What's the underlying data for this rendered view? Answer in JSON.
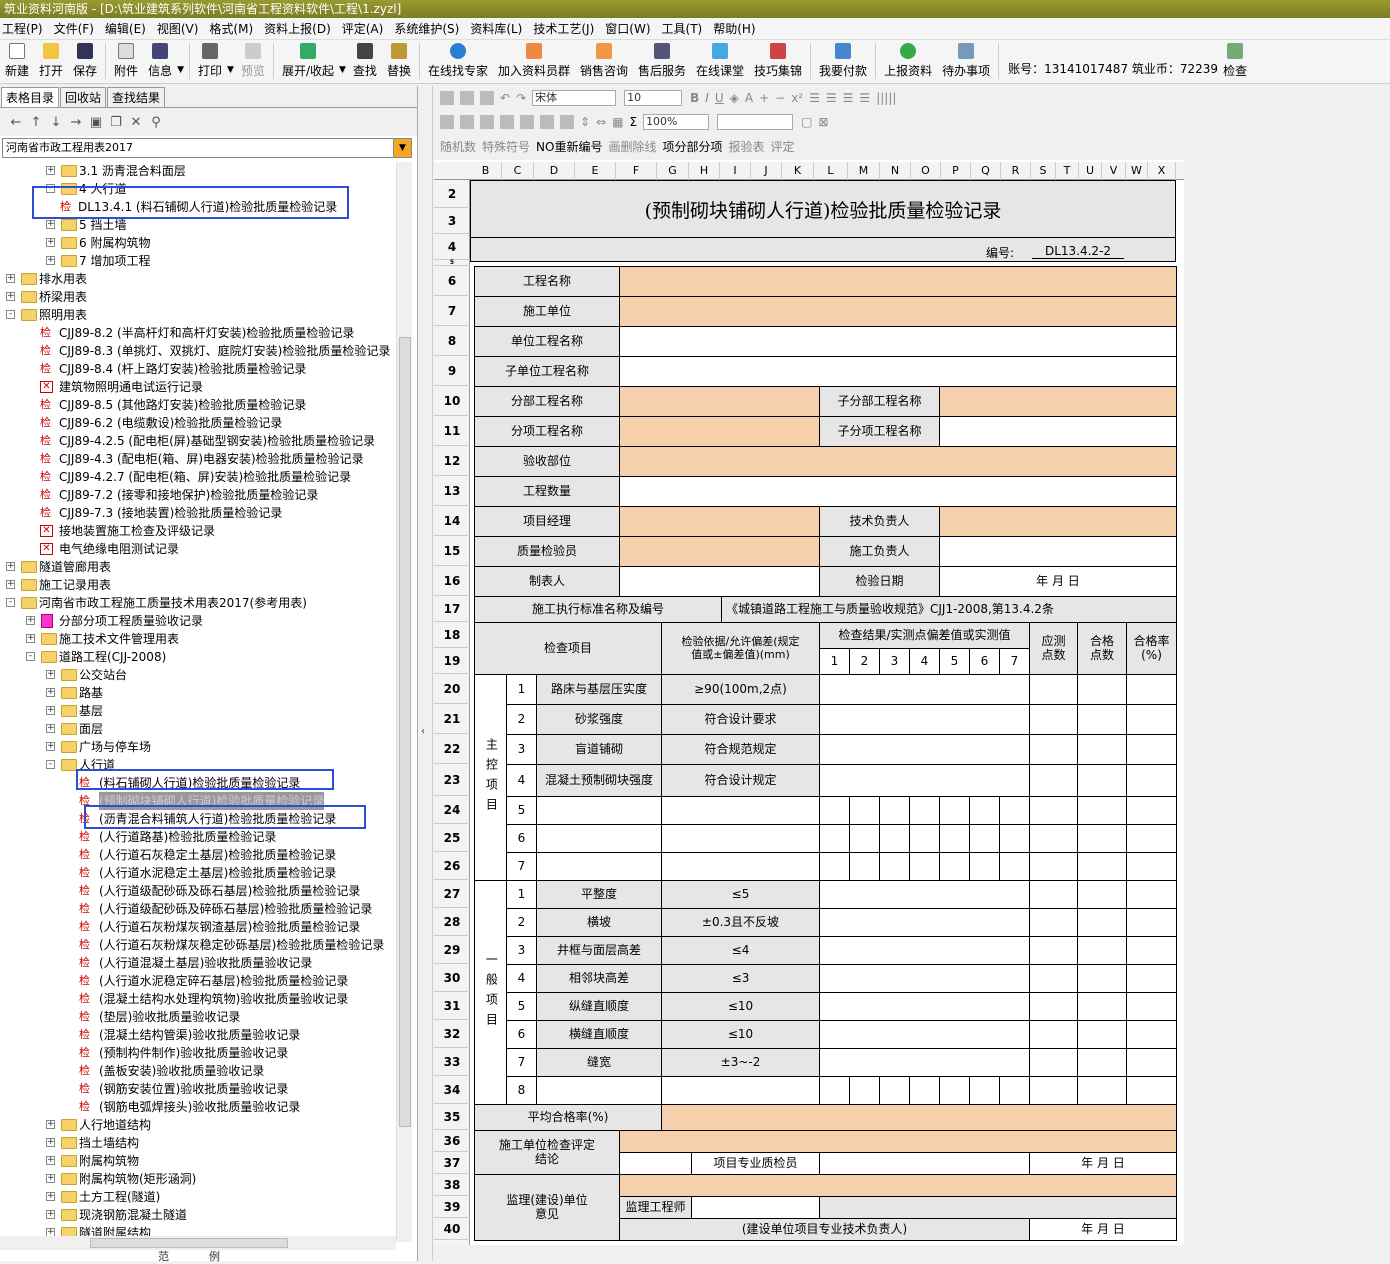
{
  "window": {
    "title": "筑业资料河南版 - [D:\\筑业建筑系列软件\\河南省工程资料软件\\工程\\1.zyzl]"
  },
  "menu": [
    "工程(P)",
    "文件(F)",
    "编辑(E)",
    "视图(V)",
    "格式(M)",
    "资料上报(D)",
    "评定(A)",
    "系统维护(S)",
    "资料库(L)",
    "技术工艺(J)",
    "窗口(W)",
    "工具(T)",
    "帮助(H)"
  ],
  "toolbar": {
    "new": "新建",
    "open": "打开",
    "save": "保存",
    "attach": "附件",
    "info": "信息",
    "print": "打印",
    "preview": "预览",
    "expand": "展开/收起",
    "find": "查找",
    "replace": "替换",
    "online_expert": "在线找专家",
    "join_group": "加入资料员群",
    "sales": "销售咨询",
    "after_sales": "售后服务",
    "online_class": "在线课堂",
    "skills": "技巧集锦",
    "pay": "我要付款",
    "upload": "上报资料",
    "todo": "待办事项",
    "account": "账号：13141017487 筑业币：72239",
    "check": "检查"
  },
  "left": {
    "tabs": [
      "表格目录",
      "回收站",
      "查找结果"
    ],
    "combo": "河南省市政工程用表2017",
    "bottom": "范例",
    "tree": [
      {
        "l": "3.1 沥青混合料面层",
        "i": 2,
        "t": "fold",
        "e": "+"
      },
      {
        "l": "4 人行道",
        "i": 2,
        "t": "fold",
        "e": "-"
      },
      {
        "l": "DL13.4.1 (料石铺砌人行道)检验批质量检验记录",
        "i": 3,
        "t": "jian"
      },
      {
        "l": "5 挡土墙",
        "i": 2,
        "t": "fold",
        "e": "+"
      },
      {
        "l": "6 附属构筑物",
        "i": 2,
        "t": "fold",
        "e": "+"
      },
      {
        "l": "7 增加项工程",
        "i": 2,
        "t": "fold",
        "e": "+"
      },
      {
        "l": "排水用表",
        "i": 0,
        "t": "fold",
        "e": "+"
      },
      {
        "l": "桥梁用表",
        "i": 0,
        "t": "fold",
        "e": "+"
      },
      {
        "l": "照明用表",
        "i": 0,
        "t": "fold",
        "e": "-"
      },
      {
        "l": "CJJ89-8.2 (半高杆灯和高杆灯安装)检验批质量检验记录",
        "i": 1,
        "t": "jian"
      },
      {
        "l": "CJJ89-8.3 (单挑灯、双挑灯、庭院灯安装)检验批质量检验记录",
        "i": 1,
        "t": "jian"
      },
      {
        "l": "CJJ89-8.4 (杆上路灯安装)检验批质量检验记录",
        "i": 1,
        "t": "jian"
      },
      {
        "l": "建筑物照明通电试运行记录",
        "i": 1,
        "t": "x"
      },
      {
        "l": "CJJ89-8.5 (其他路灯安装)检验批质量检验记录",
        "i": 1,
        "t": "jian"
      },
      {
        "l": "CJJ89-6.2 (电缆敷设)检验批质量检验记录",
        "i": 1,
        "t": "jian"
      },
      {
        "l": "CJJ89-4.2.5 (配电柜(屏)基础型钢安装)检验批质量检验记录",
        "i": 1,
        "t": "jian"
      },
      {
        "l": "CJJ89-4.3 (配电柜(箱、屏)电器安装)检验批质量检验记录",
        "i": 1,
        "t": "jian"
      },
      {
        "l": "CJJ89-4.2.7 (配电柜(箱、屏)安装)检验批质量检验记录",
        "i": 1,
        "t": "jian"
      },
      {
        "l": "CJJ89-7.2 (接零和接地保护)检验批质量检验记录",
        "i": 1,
        "t": "jian"
      },
      {
        "l": "CJJ89-7.3 (接地装置)检验批质量检验记录",
        "i": 1,
        "t": "jian"
      },
      {
        "l": "接地装置施工检查及评级记录",
        "i": 1,
        "t": "x"
      },
      {
        "l": "电气绝缘电阻测试记录",
        "i": 1,
        "t": "x"
      },
      {
        "l": "隧道管廊用表",
        "i": 0,
        "t": "fold",
        "e": "+"
      },
      {
        "l": "施工记录用表",
        "i": 0,
        "t": "fold",
        "e": "+"
      },
      {
        "l": "河南省市政工程施工质量技术用表2017(参考用表)",
        "i": 0,
        "t": "fold",
        "e": "-"
      },
      {
        "l": "分部分项工程质量验收记录",
        "i": 1,
        "t": "p",
        "e": "+"
      },
      {
        "l": "施工技术文件管理用表",
        "i": 1,
        "t": "fold",
        "e": "+"
      },
      {
        "l": "道路工程(CJJ-2008)",
        "i": 1,
        "t": "fold",
        "e": "-"
      },
      {
        "l": "公交站台",
        "i": 2,
        "t": "fold",
        "e": "+"
      },
      {
        "l": "路基",
        "i": 2,
        "t": "fold",
        "e": "+"
      },
      {
        "l": "基层",
        "i": 2,
        "t": "fold",
        "e": "+"
      },
      {
        "l": "面层",
        "i": 2,
        "t": "fold",
        "e": "+"
      },
      {
        "l": "广场与停车场",
        "i": 2,
        "t": "fold",
        "e": "+"
      },
      {
        "l": "人行道",
        "i": 2,
        "t": "fold",
        "e": "-"
      },
      {
        "l": "(料石铺砌人行道)检验批质量检验记录",
        "i": 3,
        "t": "jian"
      },
      {
        "l": "(预制砌块铺砌人行道)检验批质量检验记录",
        "i": 3,
        "t": "jian",
        "sel": true
      },
      {
        "l": "(沥青混合料铺筑人行道)检验批质量检验记录",
        "i": 3,
        "t": "jian"
      },
      {
        "l": "(人行道路基)检验批质量检验记录",
        "i": 3,
        "t": "jian"
      },
      {
        "l": "(人行道石灰稳定土基层)检验批质量检验记录",
        "i": 3,
        "t": "jian"
      },
      {
        "l": "(人行道水泥稳定土基层)检验批质量检验记录",
        "i": 3,
        "t": "jian"
      },
      {
        "l": "(人行道级配砂砾及砾石基层)检验批质量检验记录",
        "i": 3,
        "t": "jian"
      },
      {
        "l": "(人行道级配砂砾及碎砾石基层)检验批质量检验记录",
        "i": 3,
        "t": "jian"
      },
      {
        "l": "(人行道石灰粉煤灰钢渣基层)检验批质量检验记录",
        "i": 3,
        "t": "jian"
      },
      {
        "l": "(人行道石灰粉煤灰稳定砂砾基层)检验批质量检验记录",
        "i": 3,
        "t": "jian"
      },
      {
        "l": "(人行道混凝土基层)验收批质量验收记录",
        "i": 3,
        "t": "jian"
      },
      {
        "l": "(人行道水泥稳定碎石基层)检验批质量检验记录",
        "i": 3,
        "t": "jian"
      },
      {
        "l": "(混凝土结构水处理构筑物)验收批质量验收记录",
        "i": 3,
        "t": "jian"
      },
      {
        "l": "(垫层)验收批质量验收记录",
        "i": 3,
        "t": "jian"
      },
      {
        "l": "(混凝土结构管渠)验收批质量验收记录",
        "i": 3,
        "t": "jian"
      },
      {
        "l": "(预制构件制作)验收批质量验收记录",
        "i": 3,
        "t": "jian"
      },
      {
        "l": "(盖板安装)验收批质量验收记录",
        "i": 3,
        "t": "jian"
      },
      {
        "l": "(钢筋安装位置)验收批质量验收记录",
        "i": 3,
        "t": "jian"
      },
      {
        "l": "(钢筋电弧焊接头)验收批质量验收记录",
        "i": 3,
        "t": "jian"
      },
      {
        "l": "人行地道结构",
        "i": 2,
        "t": "fold",
        "e": "+"
      },
      {
        "l": "挡土墙结构",
        "i": 2,
        "t": "fold",
        "e": "+"
      },
      {
        "l": "附属构筑物",
        "i": 2,
        "t": "fold",
        "e": "+"
      },
      {
        "l": "附属构筑物(矩形涵洞)",
        "i": 2,
        "t": "fold",
        "e": "+"
      },
      {
        "l": "土方工程(隧道)",
        "i": 2,
        "t": "fold",
        "e": "+"
      },
      {
        "l": "现浇钢筋混凝土隧道",
        "i": 2,
        "t": "fold",
        "e": "+"
      },
      {
        "l": "隧道附属结构",
        "i": 2,
        "t": "fold",
        "e": "+"
      }
    ]
  },
  "rtool": {
    "font": "宋体",
    "size": "10",
    "zoom": "100%",
    "sigma": "Σ",
    "row3": [
      "随机数",
      "特殊符号",
      "NO重新编号",
      "画删除线",
      "项分部分项",
      "报验表",
      "评定"
    ]
  },
  "cols": [
    "B",
    "C",
    "D",
    "E",
    "F",
    "G",
    "H",
    "I",
    "J",
    "K",
    "L",
    "M",
    "N",
    "O",
    "P",
    "Q",
    "R",
    "S",
    "T",
    "U",
    "V",
    "W",
    "X"
  ],
  "rows": [
    "2",
    "3",
    "4",
    "5",
    "6",
    "7",
    "8",
    "9",
    "10",
    "11",
    "12",
    "13",
    "14",
    "15",
    "16",
    "17",
    "18",
    "19",
    "20",
    "21",
    "22",
    "23",
    "24",
    "25",
    "26",
    "27",
    "28",
    "29",
    "30",
    "31",
    "32",
    "33",
    "34",
    "35",
    "36",
    "37",
    "38",
    "39",
    "40"
  ],
  "doc": {
    "title": "(预制砌块铺砌人行道)检验批质量检验记录",
    "num_label": "编号:",
    "num_value": "DL13.4.2-2",
    "project_name": "工程名称",
    "construction_unit": "施工单位",
    "unit_project": "单位工程名称",
    "sub_unit_project": "子单位工程名称",
    "division": "分部工程名称",
    "sub_division": "子分部工程名称",
    "item": "分项工程名称",
    "sub_item": "子分项工程名称",
    "accept_part": "验收部位",
    "quantity": "工程数量",
    "pm": "项目经理",
    "tech_lead": "技术负责人",
    "qc": "质量检验员",
    "const_lead": "施工负责人",
    "preparer": "制表人",
    "check_date": "检验日期",
    "ymd": "年  月  日",
    "std_label": "施工执行标准名称及编号",
    "std_value": "《城镇道路工程施工与质量验收规范》CJJ1-2008,第13.4.2条",
    "h_item": "检查项目",
    "h_basis": "检验依据/允许偏差(规定值或±偏差值)(mm)",
    "h_result": "检查结果/实测点偏差值或实测值",
    "h_should": "应测点数",
    "h_pass": "合格点数",
    "h_rate": "合格率(%)",
    "idx": [
      "1",
      "2",
      "3",
      "4",
      "5",
      "6",
      "7"
    ],
    "main_label": "主控项目",
    "general_label": "一般项目",
    "main": [
      {
        "n": "1",
        "name": "路床与基层压实度",
        "basis": "≥90(100m,2点)"
      },
      {
        "n": "2",
        "name": "砂浆强度",
        "basis": "符合设计要求"
      },
      {
        "n": "3",
        "name": "盲道铺砌",
        "basis": "符合规范规定"
      },
      {
        "n": "4",
        "name": "混凝土预制砌块强度",
        "basis": "符合设计规定"
      },
      {
        "n": "5",
        "name": "",
        "basis": ""
      },
      {
        "n": "6",
        "name": "",
        "basis": ""
      },
      {
        "n": "7",
        "name": "",
        "basis": ""
      }
    ],
    "general": [
      {
        "n": "1",
        "name": "平整度",
        "basis": "≤5"
      },
      {
        "n": "2",
        "name": "横坡",
        "basis": "±0.3且不反坡"
      },
      {
        "n": "3",
        "name": "井框与面层高差",
        "basis": "≤4"
      },
      {
        "n": "4",
        "name": "相邻块高差",
        "basis": "≤3"
      },
      {
        "n": "5",
        "name": "纵缝直顺度",
        "basis": "≤10"
      },
      {
        "n": "6",
        "name": "横缝直顺度",
        "basis": "≤10"
      },
      {
        "n": "7",
        "name": "缝宽",
        "basis": "±3~-2"
      },
      {
        "n": "8",
        "name": "",
        "basis": ""
      }
    ],
    "avg_rate": "平均合格率(%)",
    "const_conclusion": "施工单位检查评定结论",
    "pro_inspector": "项目专业质检员",
    "supervision": "监理(建设)单位意见",
    "sup_engineer": "监理工程师",
    "owner_rep": "(建设单位项目专业技术负责人)"
  },
  "colors": {
    "input": "#f6cfad",
    "label": "#e6e6e6",
    "highlight": "#2a4fd6",
    "titlebar": "#8a8a2a"
  }
}
